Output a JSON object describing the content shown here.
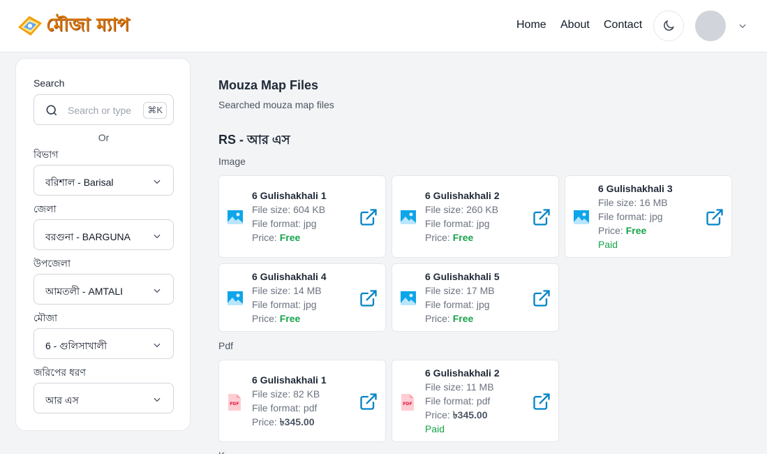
{
  "header": {
    "logo_text": "মৌজা ম্যাপ",
    "nav": [
      "Home",
      "About",
      "Contact"
    ]
  },
  "sidebar": {
    "search_label": "Search",
    "search_placeholder": "Search or type",
    "shortcut": "⌘K",
    "or_text": "Or",
    "fields": [
      {
        "label": "বিভাগ",
        "value": "বরিশাল - Barisal"
      },
      {
        "label": "জেলা",
        "value": "বরগুনা - BARGUNA"
      },
      {
        "label": "উপজেলা",
        "value": "আমতলী - AMTALI"
      },
      {
        "label": "মৌজা",
        "value": "6 - গুলিসাখালী"
      },
      {
        "label": "জরিপের ধরণ",
        "value": "আর এস"
      }
    ]
  },
  "main": {
    "title": "Mouza Map Files",
    "subtitle": "Searched mouza map files",
    "section_title": "RS - আর এস",
    "image_label": "Image",
    "pdf_label": "Pdf",
    "cut_label": "K"
  },
  "files": {
    "image": [
      {
        "name": "6 Gulishakhali 1",
        "size": "File size: 604 KB",
        "format": "File format: jpg",
        "price_label": "Price:",
        "price": "Free",
        "status": ""
      },
      {
        "name": "6 Gulishakhali 2",
        "size": "File size: 260 KB",
        "format": "File format: jpg",
        "price_label": "Price:",
        "price": "Free",
        "status": ""
      },
      {
        "name": "6 Gulishakhali 3",
        "size": "File size: 16 MB",
        "format": "File format: jpg",
        "price_label": "Price:",
        "price": "Free",
        "status": "Paid"
      },
      {
        "name": "6 Gulishakhali 4",
        "size": "File size: 14 MB",
        "format": "File format: jpg",
        "price_label": "Price:",
        "price": "Free",
        "status": ""
      },
      {
        "name": "6 Gulishakhali 5",
        "size": "File size: 17 MB",
        "format": "File format: jpg",
        "price_label": "Price:",
        "price": "Free",
        "status": ""
      }
    ],
    "pdf": [
      {
        "name": "6 Gulishakhali 1",
        "size": "File size: 82 KB",
        "format": "File format: pdf",
        "price_label": "Price:",
        "price": "৳345.00",
        "status": ""
      },
      {
        "name": "6 Gulishakhali 2",
        "size": "File size: 11 MB",
        "format": "File format: pdf",
        "price_label": "Price:",
        "price": "৳345.00",
        "status": "Paid"
      }
    ]
  },
  "colors": {
    "accent": "#0284c7",
    "free": "#16a34a",
    "logo": "#d97706"
  }
}
